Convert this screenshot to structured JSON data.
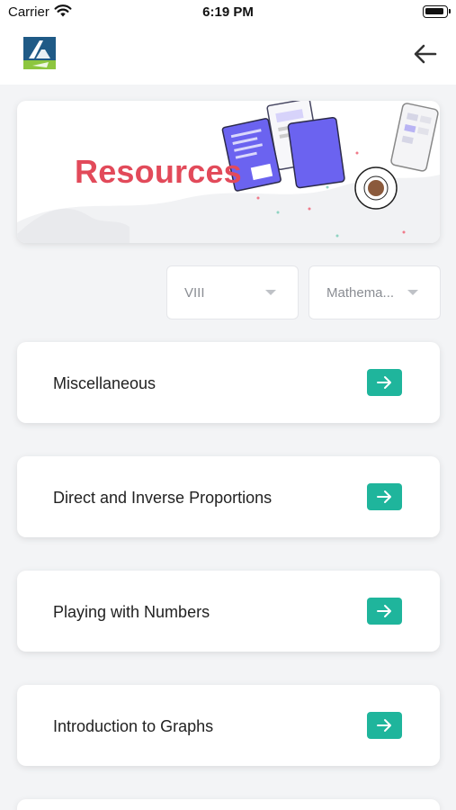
{
  "status_bar": {
    "carrier": "Carrier",
    "time": "6:19 PM"
  },
  "header": {
    "logo_icon": "app-logo-icon",
    "back_icon": "arrow-left-icon"
  },
  "banner": {
    "title": "Resources"
  },
  "filters": {
    "class_value": "VIII",
    "subject_value": "Mathema..."
  },
  "topics": [
    {
      "label": "Miscellaneous"
    },
    {
      "label": "Direct and Inverse Proportions"
    },
    {
      "label": "Playing with Numbers"
    },
    {
      "label": "Introduction to Graphs"
    },
    {
      "label": ""
    }
  ],
  "colors": {
    "accent": "#1fb59c",
    "banner_title": "#e24a5a",
    "illustration": "#6b63f0"
  }
}
